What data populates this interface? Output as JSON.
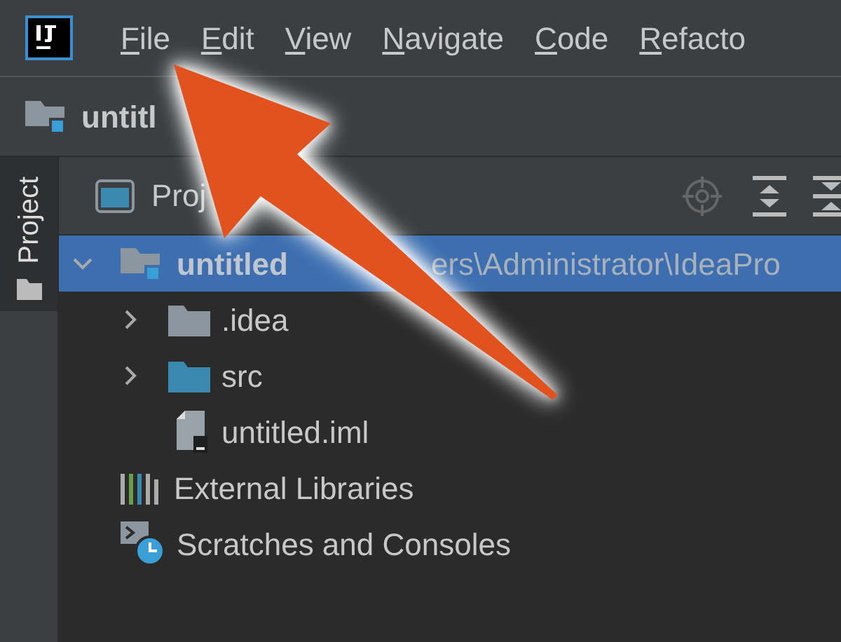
{
  "menu_bar": {
    "items": [
      {
        "label": "File"
      },
      {
        "label": "Edit"
      },
      {
        "label": "View"
      },
      {
        "label": "Navigate"
      },
      {
        "label": "Code"
      },
      {
        "label": "Refacto"
      }
    ]
  },
  "breadcrumb": {
    "label": "untitl"
  },
  "tool_strip": {
    "label": "Project",
    "selected": true
  },
  "panel": {
    "title": "Proj"
  },
  "tree": [
    {
      "kind": "module",
      "label": "untitled",
      "path": "ers\\Administrator\\IdeaPro",
      "expanded": true,
      "selected": true,
      "children": [
        {
          "kind": "folder",
          "label": ".idea",
          "expanded": false,
          "selected": false
        },
        {
          "kind": "source",
          "label": "src",
          "expanded": false,
          "selected": false
        },
        {
          "kind": "file",
          "label": "untitled.iml",
          "selected": false
        }
      ]
    },
    {
      "kind": "libraries",
      "label": "External Libraries",
      "selected": false
    },
    {
      "kind": "scratches",
      "label": "Scratches and Consoles",
      "selected": false
    }
  ]
}
